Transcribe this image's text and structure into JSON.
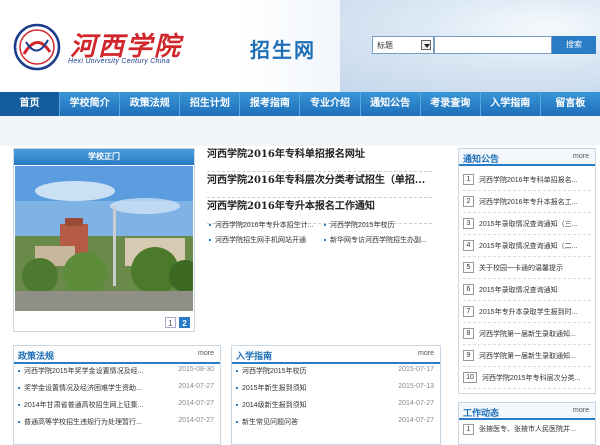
{
  "header": {
    "logo_cn": "河西学院",
    "logo_en": "Hexi University Century China",
    "site_name": "招生网",
    "search_select": "标题",
    "search_button": "搜索"
  },
  "nav": [
    "首页",
    "学校简介",
    "政策法规",
    "招生计划",
    "报考指南",
    "专业介绍",
    "通知公告",
    "考录查询",
    "入学指南",
    "留言板"
  ],
  "photo": {
    "title": "学校正门",
    "pages": [
      "1",
      "2"
    ]
  },
  "headlines": [
    "河西学院2016年专科单招报名网址",
    "河西学院2016年专科层次分类考试招生（单招...",
    "河西学院2016年专升本报名工作通知"
  ],
  "minilinks": [
    [
      "河西学院2016年专升本招生计...",
      "河西学院2015年校历"
    ],
    [
      "河西学院招生网手机网站开通",
      "新华网专访河西学院招生办副..."
    ]
  ],
  "notices": {
    "title": "通知公告",
    "more": "more",
    "items": [
      {
        "num": "1",
        "text": "河西学院2016年专科单招报名..."
      },
      {
        "num": "2",
        "text": "河西学院2016年专升本报名工..."
      },
      {
        "num": "3",
        "text": "2015年录取情况查询通知（三..."
      },
      {
        "num": "4",
        "text": "2015年录取情况查询通知（二..."
      },
      {
        "num": "5",
        "text": "关于校园一卡通的温馨提示"
      },
      {
        "num": "6",
        "text": "2015年录取情况查询通知"
      },
      {
        "num": "7",
        "text": "2015年专升本录取学生报到时..."
      },
      {
        "num": "8",
        "text": "河西学院第一届新生录取通知..."
      },
      {
        "num": "9",
        "text": "河西学院第一届新生录取通知..."
      },
      {
        "num": "10",
        "text": "河西学院2015年专科层次分类..."
      }
    ]
  },
  "policy": {
    "title": "政策法规",
    "more": "more",
    "items": [
      {
        "text": "河西学院2015年奖学金设置情况及经...",
        "date": "2015-08-30"
      },
      {
        "text": "奖学金设置情况及经济困难学生资助...",
        "date": "2014-07-27"
      },
      {
        "text": "2014年甘肃省普通高校招生网上征集...",
        "date": "2014-07-27"
      },
      {
        "text": "普通高等学校招生违规行为处理暂行...",
        "date": "2014-07-27"
      }
    ]
  },
  "guide": {
    "title": "入学指南",
    "more": "more",
    "items": [
      {
        "text": "河西学院2015年校历",
        "date": "2015-07-17"
      },
      {
        "text": "2015年新生报到须知",
        "date": "2015-07-13"
      },
      {
        "text": "2014级新生报到须知",
        "date": "2014-07-27"
      },
      {
        "text": "新生常见问题问答",
        "date": "2014-07-27"
      }
    ]
  },
  "work": {
    "title": "工作动态",
    "more": "more",
    "items": [
      {
        "num": "1",
        "text": "张掖医专、张掖市人民医院并..."
      }
    ]
  }
}
